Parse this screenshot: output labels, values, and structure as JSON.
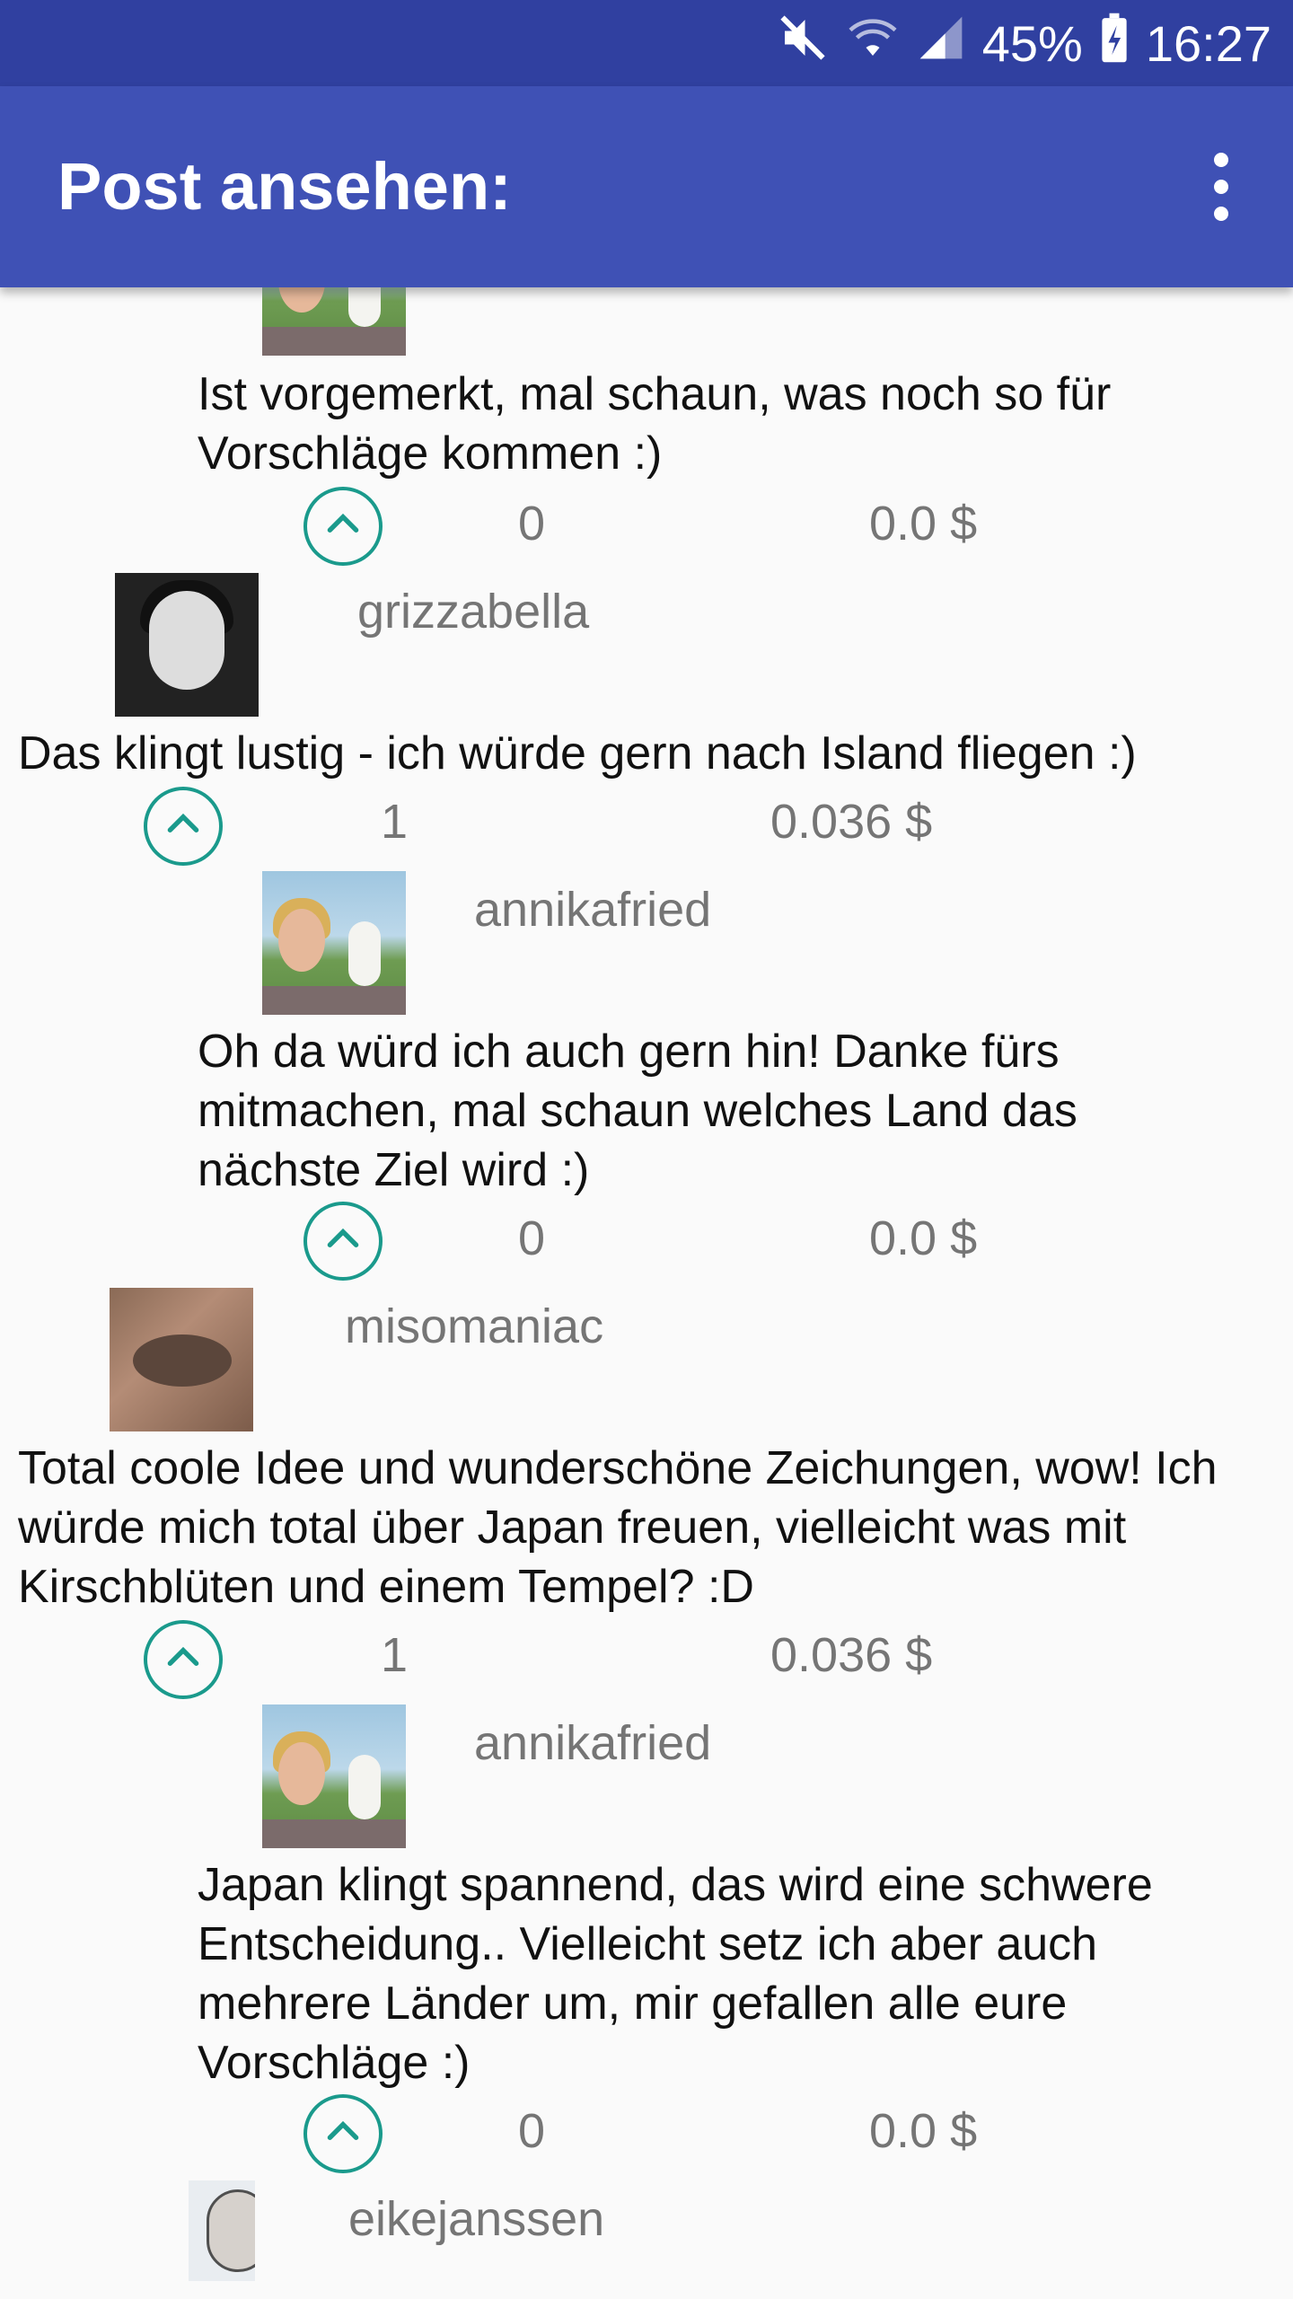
{
  "status_bar": {
    "mute_icon": "volume-off-icon",
    "wifi_icon": "wifi-icon",
    "signal_icon": "signal-icon",
    "battery": "45%",
    "battery_icon": "battery-charging-icon",
    "time": "16:27"
  },
  "app_bar": {
    "title": "Post ansehen:",
    "menu_icon": "more-vertical-icon",
    "color": "#3f51b5"
  },
  "comments": [
    {
      "username": "",
      "text": "Ist vorgemerkt, mal schaun, was noch so für Vorschläge kommen :)",
      "votes": "0",
      "payout": "0.0 $"
    },
    {
      "username": "grizzabella",
      "text": "Das klingt lustig - ich würde gern nach Island fliegen :)",
      "votes": "1",
      "payout": "0.036 $"
    },
    {
      "username": "annikafried",
      "text": "Oh da würd ich auch gern hin! Danke fürs mitmachen, mal schaun welches Land das nächste Ziel wird :)",
      "votes": "0",
      "payout": "0.0 $"
    },
    {
      "username": "misomaniac",
      "text": "Total coole Idee und wunderschöne Zeichungen, wow! Ich würde mich total über Japan freuen, vielleicht was mit Kirschblüten und einem Tempel? :D",
      "votes": "1",
      "payout": "0.036 $"
    },
    {
      "username": "annikafried",
      "text": "Japan klingt spannend, das wird eine schwere Entscheidung.. Vielleicht setz ich aber auch mehrere Länder um, mir gefallen alle eure Vorschläge :)",
      "votes": "0",
      "payout": "0.0 $"
    },
    {
      "username": "eikejanssen"
    }
  ],
  "upvote_icon": "chevron-up-icon",
  "accent_color": "#1a9a8c"
}
